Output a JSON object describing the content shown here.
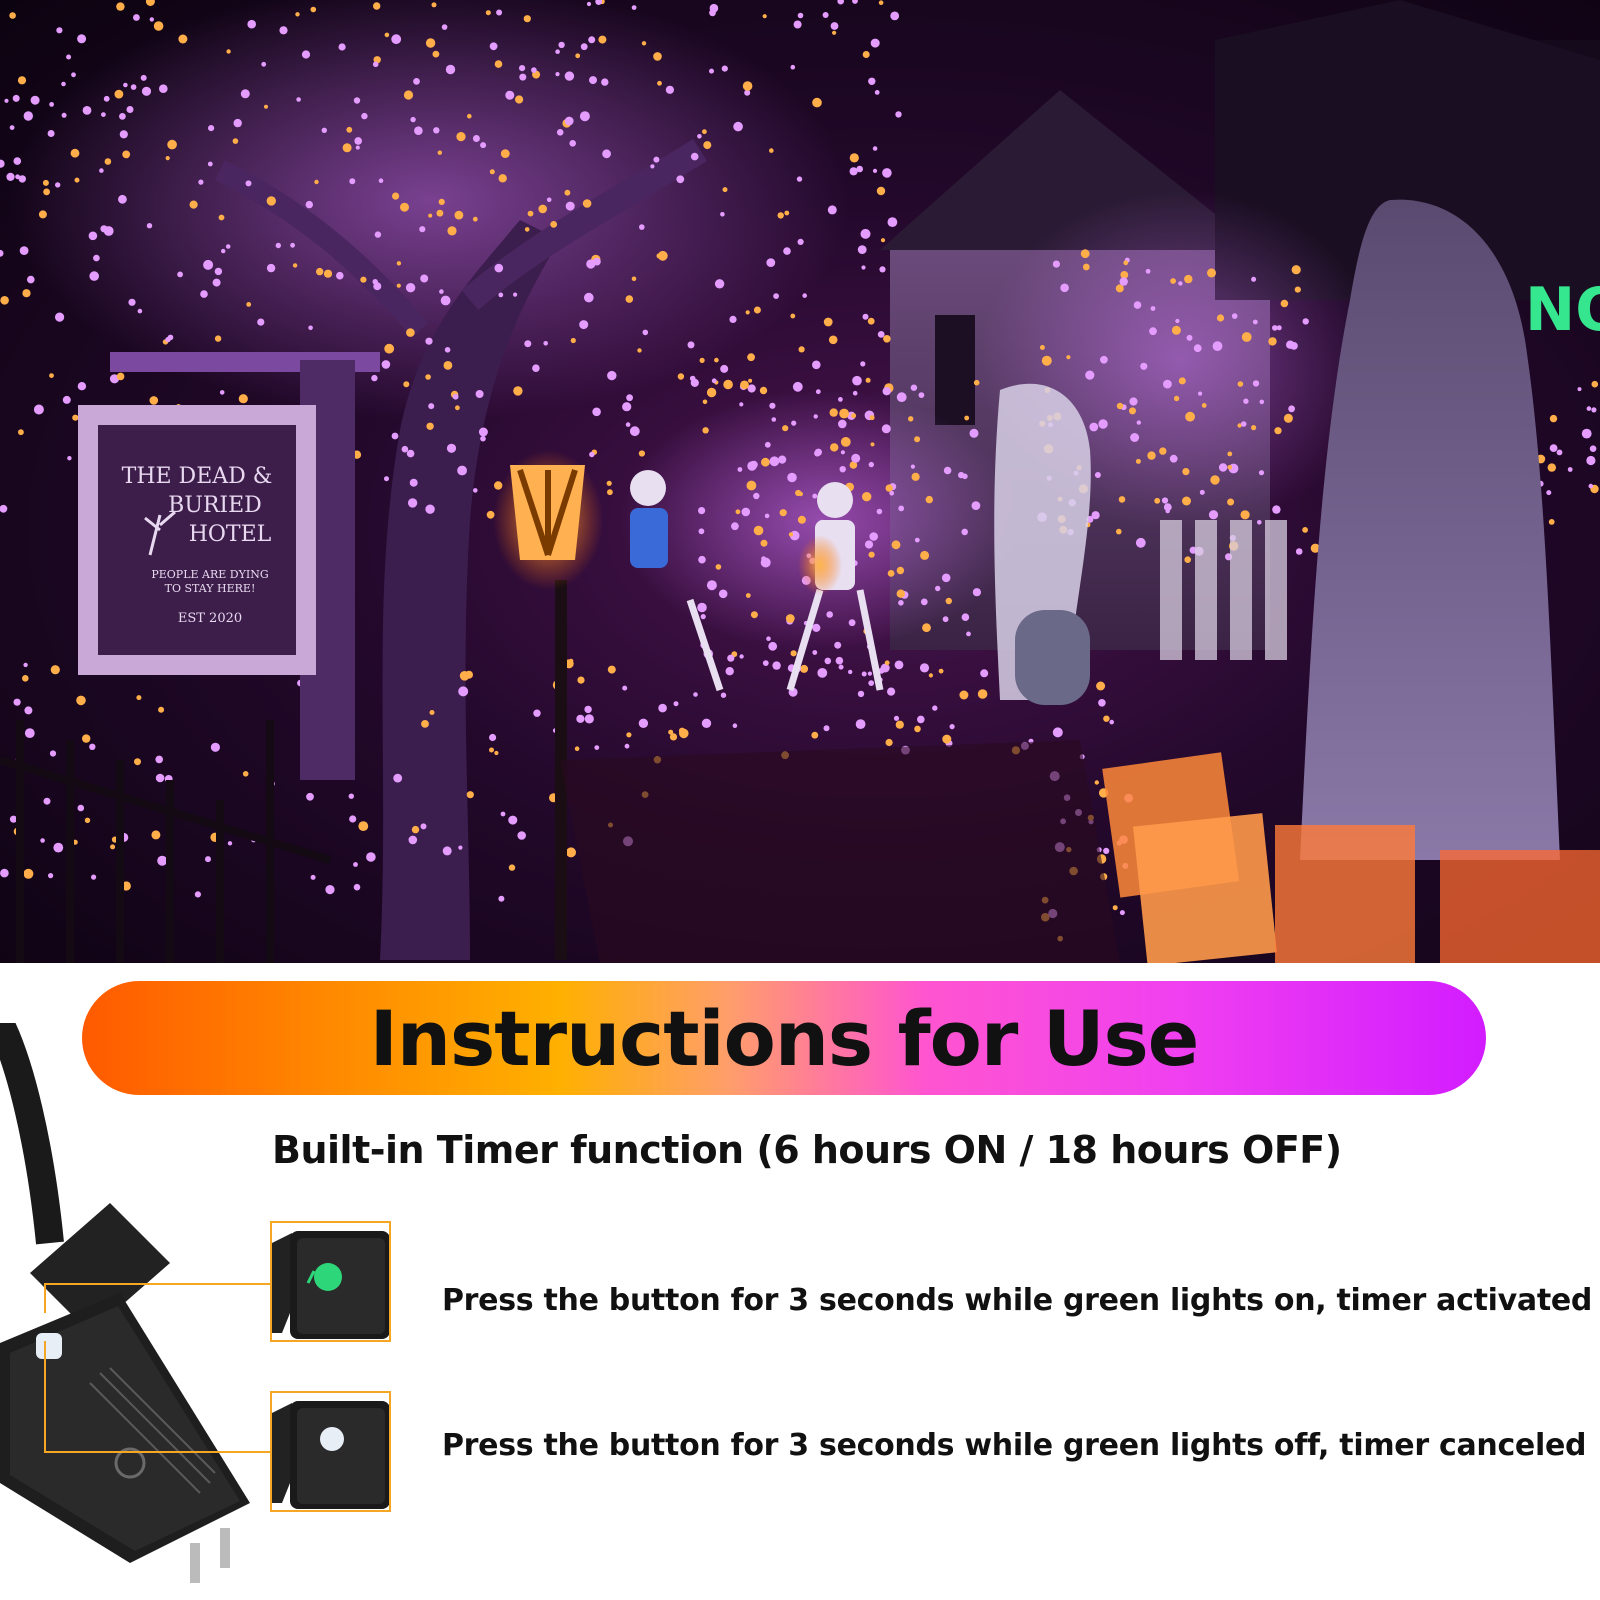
{
  "photo": {
    "sign": {
      "line1": "THE DEAD &",
      "line2": "BURIED",
      "line3": "HOTEL",
      "tagline1": "PEOPLE ARE DYING",
      "tagline2": "TO STAY HERE!",
      "est": "EST 2020"
    }
  },
  "banner": {
    "title": "Instructions for Use"
  },
  "subtitle": "Built-in Timer function (6 hours ON / 18 hours OFF)",
  "steps": [
    {
      "text": "Press the button for 3 seconds while green lights on, timer activated",
      "led": "green"
    },
    {
      "text": "Press the button for 3 seconds while green lights off, timer canceled",
      "led": "off"
    }
  ],
  "colors": {
    "accent_orange": "#f5a623",
    "led_green": "#2ed67a",
    "led_off": "#e8eef6"
  },
  "icons": [
    "adapter-icon",
    "button-closeup-icon"
  ]
}
